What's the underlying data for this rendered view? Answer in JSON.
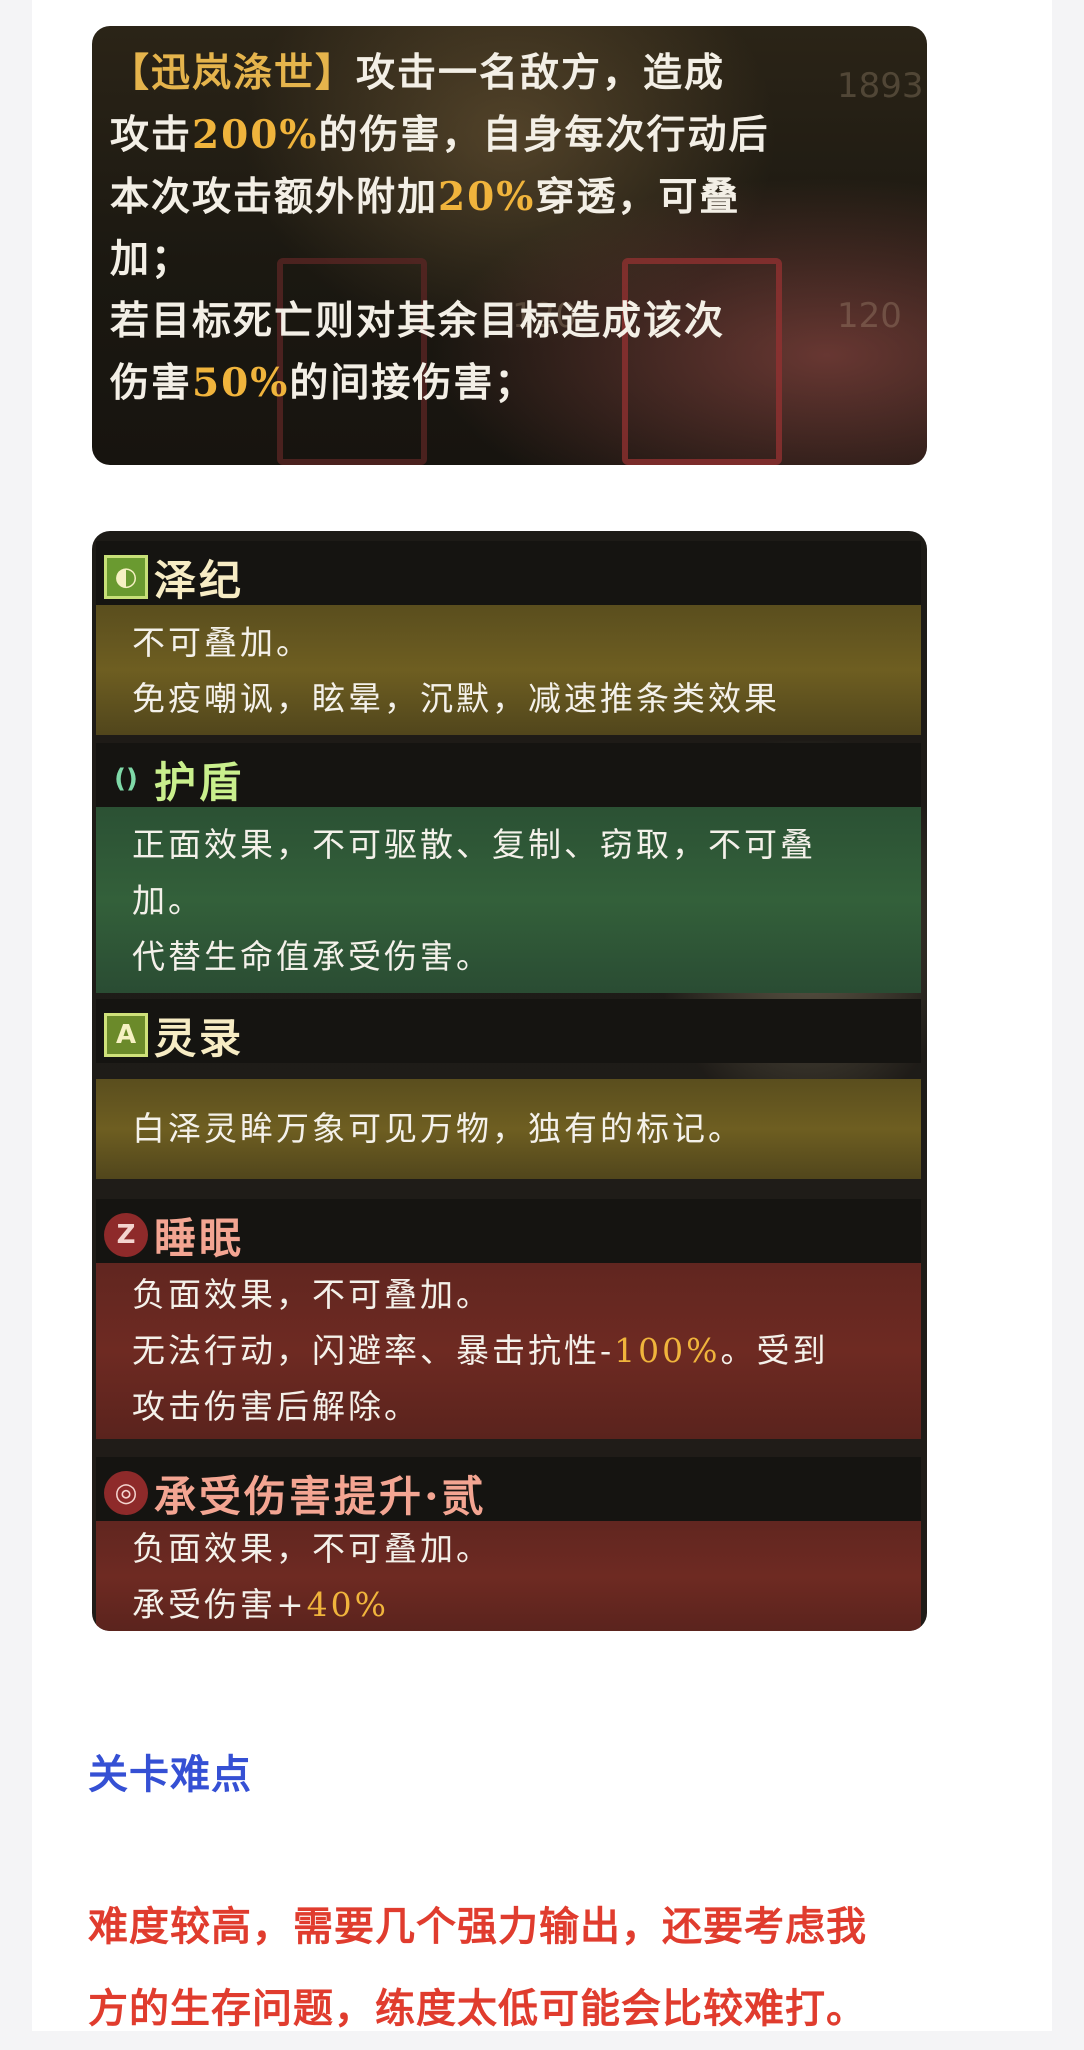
{
  "skill": {
    "name": "【迅岚涤世】",
    "lines": [
      {
        "before": "攻击一名敌方，造成",
        "hl": "",
        "after": ""
      },
      {
        "before": "攻击",
        "hl": "200%",
        "after": "的伤害，自身每次行动后"
      },
      {
        "before": "本次攻击额外附加",
        "hl": "20%",
        "after": "穿透，可叠"
      },
      {
        "before": "加；",
        "hl": "",
        "after": ""
      },
      {
        "before": "若目标死亡则对其余目标造成该次",
        "hl": "",
        "after": ""
      },
      {
        "before": "伤害",
        "hl": "50%",
        "after": "的间接伤害；"
      }
    ],
    "bg_numbers": [
      "120",
      "120",
      "1893"
    ]
  },
  "statuses": [
    {
      "icon": "shield-leaf-icon",
      "glyph": "◐",
      "title": "泽纪",
      "tone": "gold",
      "lines": [
        {
          "before": "不可叠加。",
          "hl": "",
          "after": ""
        },
        {
          "before": "免疫嘲讽，眩晕，沉默，减速推条类效果",
          "hl": "",
          "after": ""
        }
      ]
    },
    {
      "icon": "shield-icon",
      "glyph": "()",
      "title": "护盾",
      "tone": "green",
      "lines": [
        {
          "before": "正面效果，不可驱散、复制、窃取，不可叠",
          "hl": "",
          "after": ""
        },
        {
          "before": "加。",
          "hl": "",
          "after": ""
        },
        {
          "before": "代替生命值承受伤害。",
          "hl": "",
          "after": ""
        }
      ]
    },
    {
      "icon": "spirit-mark-icon",
      "glyph": "A",
      "title": "灵录",
      "tone": "gold",
      "lines": [
        {
          "before": "白泽灵眸万象可见万物，独有的标记。",
          "hl": "",
          "after": ""
        }
      ]
    },
    {
      "icon": "sleep-icon",
      "glyph": "Z",
      "title": "睡眠",
      "tone": "red",
      "lines": [
        {
          "before": "负面效果，不可叠加。",
          "hl": "",
          "after": ""
        },
        {
          "before": "无法行动，闪避率、暴击抗性-",
          "hl": "100%",
          "after": "。受到"
        },
        {
          "before": "攻击伤害后解除。",
          "hl": "",
          "after": ""
        }
      ]
    },
    {
      "icon": "damage-up-icon",
      "glyph": "◎",
      "title": "承受伤害提升·贰",
      "tone": "red",
      "lines": [
        {
          "before": "负面效果，不可叠加。",
          "hl": "",
          "after": ""
        },
        {
          "before": "承受伤害+",
          "hl": "40%",
          "after": ""
        }
      ]
    }
  ],
  "section_heading": "关卡难点",
  "paragraph": [
    "难度较高，需要几个强力输出，还要考虑我",
    "方的生存问题，练度太低可能会比较难打。"
  ],
  "colors": {
    "highlight": "#f0b43c",
    "heading_blue": "#3550d4",
    "paragraph_red": "#e03c2e"
  }
}
